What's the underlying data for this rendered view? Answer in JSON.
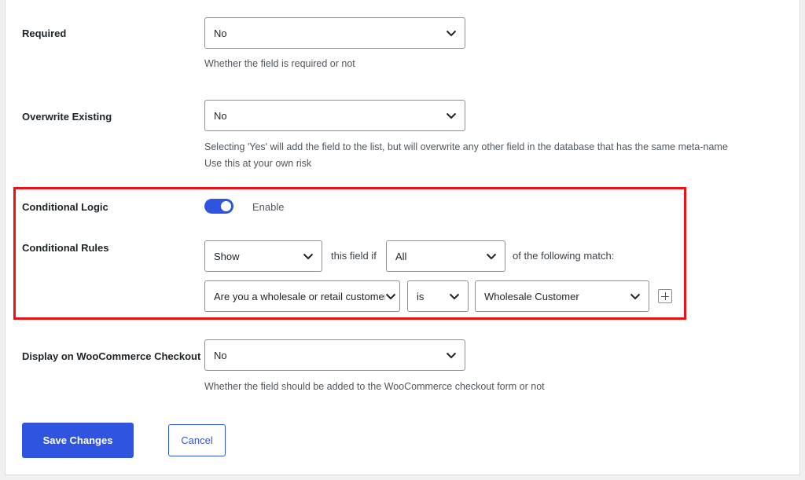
{
  "required": {
    "label": "Required",
    "value": "No",
    "description": "Whether the field is required or not"
  },
  "overwrite_existing": {
    "label": "Overwrite Existing",
    "value": "No",
    "description_line1": "Selecting 'Yes' will add the field to the list, but will overwrite any other field in the database that has the same meta-name",
    "description_line2": "Use this at your own risk"
  },
  "conditional_logic": {
    "label": "Conditional Logic",
    "enabled": true,
    "toggle_label": "Enable"
  },
  "conditional_rules": {
    "label": "Conditional Rules",
    "action_value": "Show",
    "text_this_field_if": "this field if",
    "match_value": "All",
    "text_following_match": "of the following match:",
    "rule": {
      "field_value": "Are you a wholesale or retail customer?",
      "operator_value": "is",
      "compare_value": "Wholesale Customer"
    }
  },
  "display_on_checkout": {
    "label": "Display on WooCommerce Checkout",
    "value": "No",
    "description": "Whether the field should be added to the WooCommerce checkout form or not"
  },
  "actions": {
    "save_label": "Save Changes",
    "cancel_label": "Cancel"
  },
  "icons": {
    "select_arrow": "chevron-down-icon",
    "add_rule": "plus-icon"
  },
  "colors": {
    "accent": "#2f55e0",
    "highlight_border": "#ee1111"
  }
}
